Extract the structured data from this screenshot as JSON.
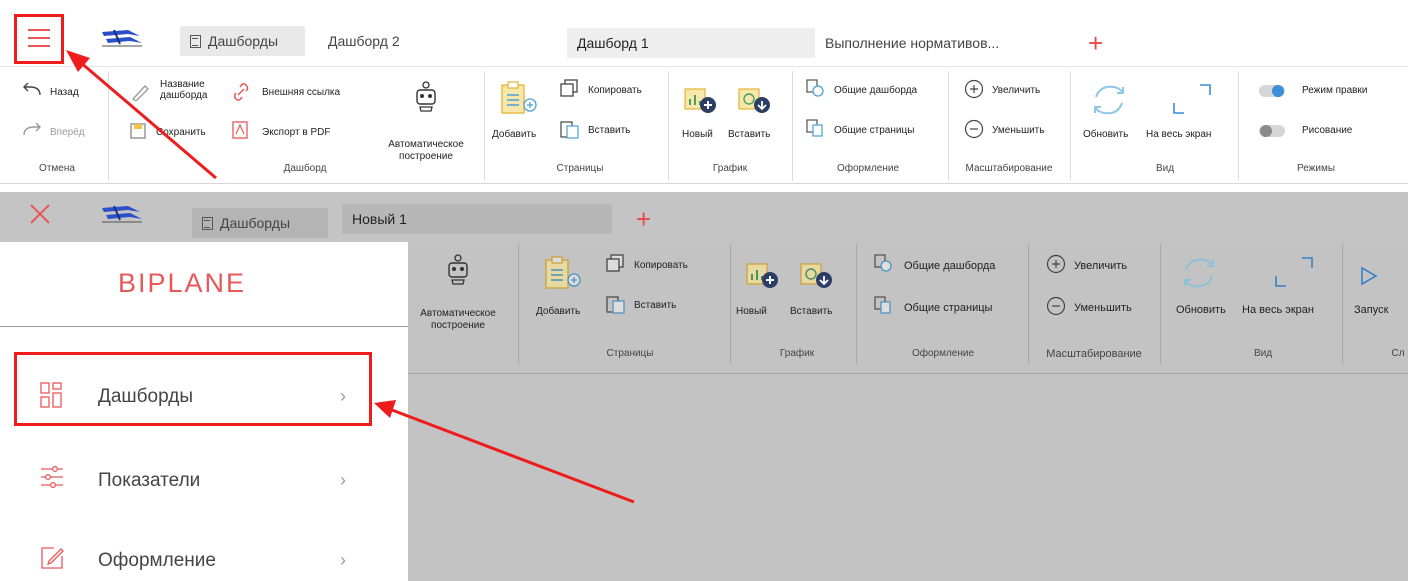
{
  "top": {
    "tabs": [
      {
        "label": "Дашборды"
      },
      {
        "label": "Дашборд 2"
      },
      {
        "label": "Дашборд 1"
      },
      {
        "label": "Выполнение нормативов..."
      }
    ],
    "ribbon": {
      "undo": {
        "back": "Назад",
        "forward": "Вперёд",
        "group": "Отмена"
      },
      "dashboard": {
        "name": "Название\nдашборда",
        "link": "Внешняя ссылка",
        "save": "Сохранить",
        "pdf": "Экспорт в PDF",
        "auto": "Автоматическое\nпостроение",
        "group": "Дашборд"
      },
      "pages": {
        "add": "Добавить",
        "copy": "Копировать",
        "paste": "Вставить",
        "group": "Страницы"
      },
      "chart": {
        "new": "Новый",
        "paste": "Вставить",
        "group": "График"
      },
      "design": {
        "common_dash": "Общие дашборда",
        "common_pages": "Общие страницы",
        "group": "Оформление"
      },
      "scale": {
        "zoom_in": "Увеличить",
        "zoom_out": "Уменьшить",
        "group": "Масштабирование"
      },
      "view": {
        "refresh": "Обновить",
        "full": "На весь экран",
        "group": "Вид"
      },
      "modes": {
        "edit": "Режим правки",
        "draw": "Рисование",
        "group": "Режимы"
      }
    }
  },
  "bottom": {
    "tabs": [
      {
        "label": "Дашборды"
      },
      {
        "label": "Новый 1"
      }
    ],
    "brand": "BIPLANE",
    "menu": [
      {
        "label": "Дашборды"
      },
      {
        "label": "Показатели"
      },
      {
        "label": "Оформление"
      }
    ],
    "ribbon": {
      "auto": "Автоматическое\nпостроение",
      "add": "Добавить",
      "copy": "Копировать",
      "paste": "Вставить",
      "pages_group": "Страницы",
      "new": "Новый",
      "chart_paste": "Вставить",
      "chart_group": "График",
      "common_dash": "Общие дашборда",
      "common_pages": "Общие страницы",
      "design_group": "Оформление",
      "zoom_in": "Увеличить",
      "zoom_out": "Уменьшить",
      "scale_group": "Масштабирование",
      "refresh": "Обновить",
      "full": "На весь экран",
      "view_group": "Вид",
      "run": "Запуск",
      "slide_group": "Сл"
    }
  },
  "colors": {
    "accent": "#e8585a",
    "annotation": "#ee1c1c"
  }
}
